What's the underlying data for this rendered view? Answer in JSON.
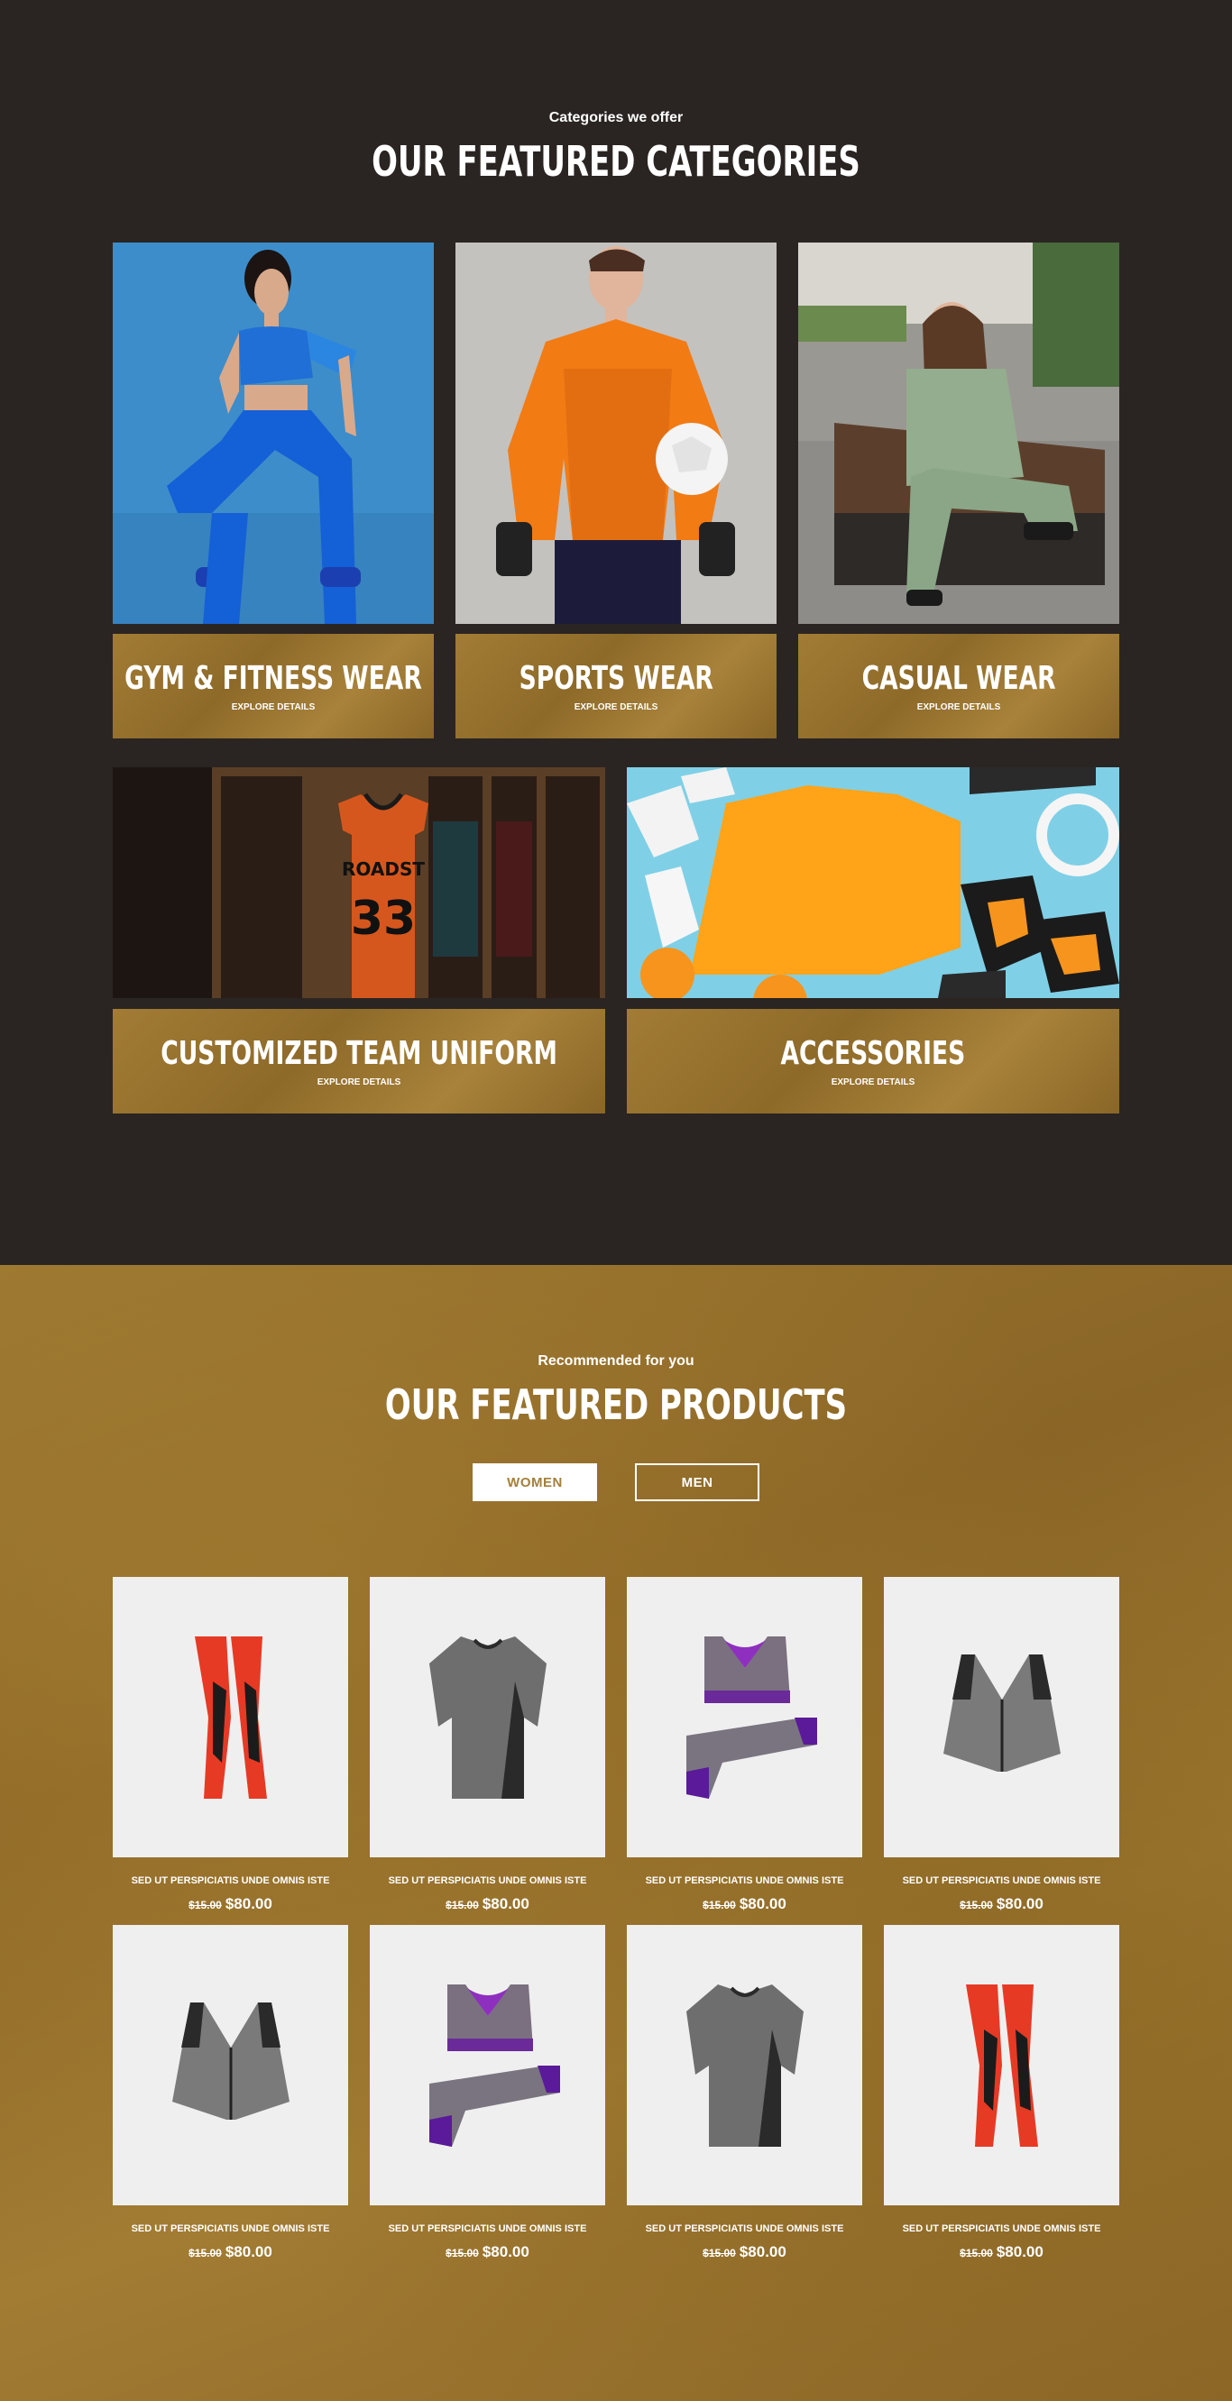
{
  "categories_section": {
    "subtitle": "Categories we offer",
    "title": "OUR FEATURED CATEGORIES",
    "items": [
      {
        "name": "GYM & FITNESS WEAR",
        "link": "EXPLORE DETAILS"
      },
      {
        "name": "SPORTS WEAR",
        "link": "EXPLORE DETAILS"
      },
      {
        "name": "CASUAL WEAR",
        "link": "EXPLORE DETAILS"
      },
      {
        "name": "CUSTOMIZED TEAM UNIFORM",
        "link": "EXPLORE DETAILS"
      },
      {
        "name": "ACCESSORIES",
        "link": "EXPLORE DETAILS"
      }
    ]
  },
  "products_section": {
    "subtitle": "Recommended for you",
    "title": "OUR FEATURED PRODUCTS",
    "tabs": [
      {
        "label": "WOMEN",
        "active": true
      },
      {
        "label": "MEN",
        "active": false
      }
    ],
    "products": [
      {
        "name": "SED UT PERSPICIATIS UNDE OMNIS ISTE",
        "old_price": "$15.00",
        "price": "$80.00",
        "image": "red-leggings"
      },
      {
        "name": "SED UT PERSPICIATIS UNDE OMNIS ISTE",
        "old_price": "$15.00",
        "price": "$80.00",
        "image": "grey-compression-shirt"
      },
      {
        "name": "SED UT PERSPICIATIS UNDE OMNIS ISTE",
        "old_price": "$15.00",
        "price": "$80.00",
        "image": "purple-bra-set"
      },
      {
        "name": "SED UT PERSPICIATIS UNDE OMNIS ISTE",
        "old_price": "$15.00",
        "price": "$80.00",
        "image": "grey-sports-bra"
      },
      {
        "name": "SED UT PERSPICIATIS UNDE OMNIS ISTE",
        "old_price": "$15.00",
        "price": "$80.00",
        "image": "grey-sports-bra"
      },
      {
        "name": "SED UT PERSPICIATIS UNDE OMNIS ISTE",
        "old_price": "$15.00",
        "price": "$80.00",
        "image": "purple-bra-set"
      },
      {
        "name": "SED UT PERSPICIATIS UNDE OMNIS ISTE",
        "old_price": "$15.00",
        "price": "$80.00",
        "image": "grey-compression-shirt"
      },
      {
        "name": "SED UT PERSPICIATIS UNDE OMNIS ISTE",
        "old_price": "$15.00",
        "price": "$80.00",
        "image": "red-leggings"
      }
    ]
  },
  "colors": {
    "dark_bg": "#2a2522",
    "gold": "#9a7630",
    "white": "#ffffff"
  }
}
